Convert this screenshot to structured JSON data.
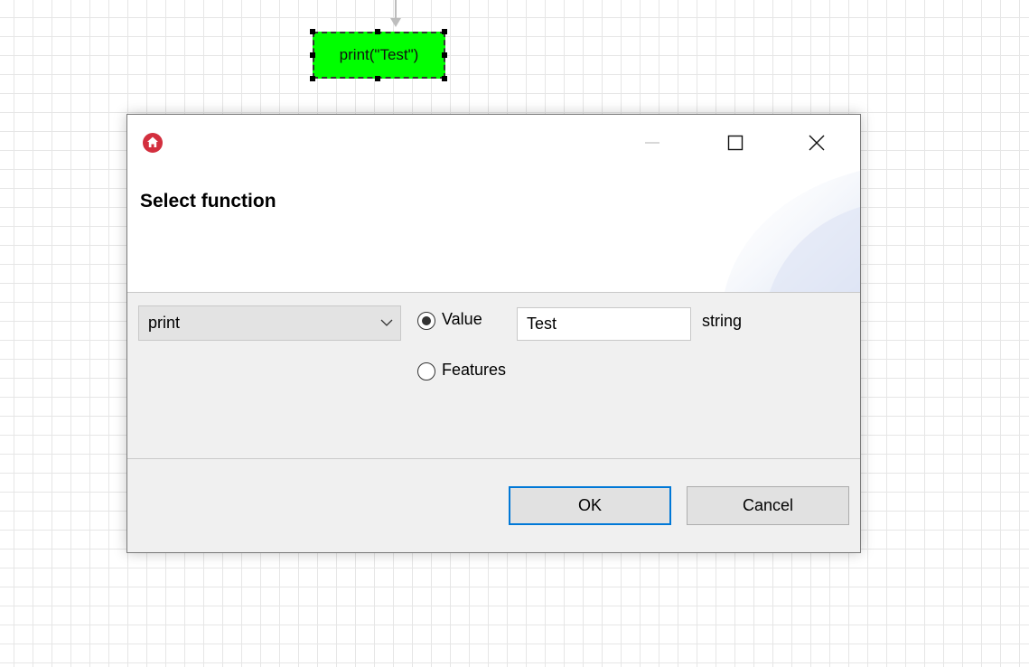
{
  "canvas": {
    "node_label": "print(\"Test\")",
    "node_color": "#00ff00"
  },
  "dialog": {
    "title": "",
    "header_title": "Select function",
    "app_icon": "home-icon",
    "window_buttons": [
      "minimize",
      "maximize",
      "close"
    ],
    "function_select": {
      "selected": "print"
    },
    "value_radio": {
      "label": "Value",
      "checked": true
    },
    "value_input": {
      "value": "Test"
    },
    "value_type": "string",
    "features_radio": {
      "label": "Features",
      "checked": false
    },
    "buttons": {
      "ok": "OK",
      "cancel": "Cancel"
    },
    "accent_color": "#0078d7",
    "icon_color": "#d32f3e"
  }
}
